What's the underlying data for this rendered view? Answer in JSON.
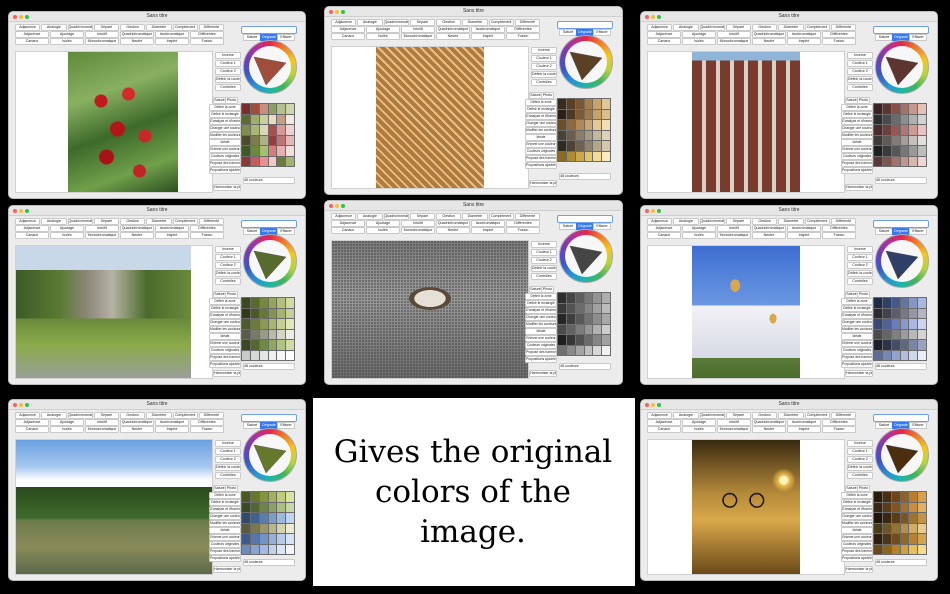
{
  "caption": [
    "Gives the original",
    "colors of the image."
  ],
  "window": {
    "title": "Sans titre",
    "top_buttons_row1": [
      "Adjacence",
      "Analogie",
      "Quadrichromatique",
      "Séparé",
      "Gestion",
      "Diamètre",
      "Complément",
      "Différenté"
    ],
    "top_buttons_row2": [
      "Adjacence",
      "Ajoutage",
      "Intuitif",
      "Quadrichromatique",
      "Isochromatique",
      "Différentes"
    ],
    "top_buttons_row3": [
      "Canaux",
      "Isolés",
      "Monochromatique",
      "Neutre",
      "Inspiré",
      "Fusion"
    ],
    "color_tabs": [
      "Saturé",
      "Dégradé",
      "Effacer"
    ],
    "wheel_buttons": [
      "Inverse",
      "Couleur 1",
      "Couleur 2",
      "Définir la couleur",
      "Contrôles"
    ],
    "swatch_tabs": [
      "Saturé",
      "Photo"
    ],
    "left_buttons": [
      "Définir la zone",
      "Définir le rectangle",
      "D'analyse et d'harmonisation",
      "Changer une couleur",
      "Modifier les couleurs",
      "Idéale",
      "Enlever une couleur",
      "Couleurs originales",
      "Propose des harmonies",
      "Propositions ajoutées aux ensembles"
    ],
    "bottom_buttons": [
      "Harmoniser la photo",
      "48 couleurs"
    ]
  },
  "windows": [
    {
      "name": "currants",
      "palette": [
        "#7a2c2e",
        "#a04e3b",
        "#c98f7d",
        "#8aa163",
        "#b6c08a",
        "#d0d4b0",
        "#5e6b2f",
        "#9fae6b",
        "#c8cf9c",
        "#e6dcc8",
        "#c0a087",
        "#f1e9e0",
        "#7e8f4d",
        "#a7b774",
        "#dcd6b8",
        "#b04a4f",
        "#d89a98",
        "#edd4d2",
        "#4a4b28",
        "#7d7e47",
        "#b0b186",
        "#9b3b3e",
        "#c27475",
        "#e4b8b7",
        "#3b5920",
        "#6d8a3a",
        "#a4bf6d",
        "#d87b7c",
        "#eab0b0",
        "#f6dede",
        "#8c3837",
        "#c75a5b",
        "#e69090",
        "#f3c8c9",
        "#6b7d3a",
        "#a3b275"
      ]
    },
    {
      "name": "bar",
      "palette": [
        "#3a2a1a",
        "#5a4024",
        "#7a5730",
        "#a67d45",
        "#c9a46a",
        "#e0c896",
        "#2b1e12",
        "#4e3821",
        "#7b5a34",
        "#9e7a46",
        "#c7a168",
        "#dcc08a",
        "#6b4e2c",
        "#8d6a3d",
        "#b08a54",
        "#caa66f",
        "#e2c894",
        "#f0dfb5",
        "#4a4034",
        "#6b5d4b",
        "#8d7e66",
        "#a89a80",
        "#c4b89e",
        "#ddd2b8",
        "#2f2a22",
        "#4d4436",
        "#6d624f",
        "#8f836b",
        "#b2a68b",
        "#d2c7ab",
        "#8a6a25",
        "#ae8a33",
        "#cca848",
        "#e2c56a",
        "#f0dc94",
        "#f9ecc0"
      ]
    },
    {
      "name": "building",
      "palette": [
        "#3b2220",
        "#5e3431",
        "#83504a",
        "#a97066",
        "#c9968b",
        "#e5c1b8",
        "#2c2c2c",
        "#4a4a4a",
        "#6b6b6b",
        "#8e8e8e",
        "#b0b0b0",
        "#d2d2d2",
        "#4a2b2a",
        "#6d3f3d",
        "#905956",
        "#b27873",
        "#cf9b95",
        "#e9c3bd",
        "#3d3a38",
        "#5e5a57",
        "#817c78",
        "#a49e99",
        "#c5c0bb",
        "#e3dfdb",
        "#1f1f1f",
        "#3a3a3a",
        "#575757",
        "#777777",
        "#9a9a9a",
        "#bdbdbd",
        "#5a3a36",
        "#7d5550",
        "#a0746e",
        "#bf958e",
        "#d8b6b0",
        "#eed6d1"
      ]
    },
    {
      "name": "stone-house",
      "palette": [
        "#3a4a1e",
        "#566b2c",
        "#74893e",
        "#94a657",
        "#b4c07a",
        "#d3d9a4",
        "#2e3a18",
        "#485a26",
        "#647838",
        "#83964f",
        "#a3b26f",
        "#c6cf98",
        "#4d5a2a",
        "#6c7b3b",
        "#8b9a52",
        "#a9b66e",
        "#c7cf92",
        "#e1e6bc",
        "#5b5b4d",
        "#7a7a6a",
        "#9a9a89",
        "#b9b9a9",
        "#d6d6c8",
        "#eeeee4",
        "#384a22",
        "#526a30",
        "#6f8a44",
        "#8fa85d",
        "#b0c37f",
        "#d0dca7",
        "#c6cac9",
        "#d5d9d8",
        "#e2e6e5",
        "#eef1f0",
        "#f6f8f7",
        "#ffffff"
      ]
    },
    {
      "name": "dog",
      "palette": [
        "#2d2d2d",
        "#454545",
        "#5e5e5e",
        "#787878",
        "#939393",
        "#aeaeae",
        "#3a3a3a",
        "#525252",
        "#6c6c6c",
        "#868686",
        "#a1a1a1",
        "#bcbcbc",
        "#262626",
        "#3e3e3e",
        "#585858",
        "#727272",
        "#8d8d8d",
        "#a8a8a8",
        "#4a4a4a",
        "#636363",
        "#7d7d7d",
        "#979797",
        "#b2b2b2",
        "#cdcdcd",
        "#1e1e1e",
        "#363636",
        "#505050",
        "#6a6a6a",
        "#858585",
        "#a0a0a0",
        "#707070",
        "#8a8a8a",
        "#a4a4a4",
        "#bebebe",
        "#d8d8d8",
        "#f0f0f0"
      ]
    },
    {
      "name": "church",
      "palette": [
        "#1e2a4a",
        "#2f3f68",
        "#455887",
        "#6275a6",
        "#8496c4",
        "#aab9df",
        "#2a2a33",
        "#42424f",
        "#5c5c6c",
        "#78788a",
        "#9595a8",
        "#b4b4c6",
        "#3a4a76",
        "#506298",
        "#6a7db6",
        "#8899cf",
        "#a9b6e2",
        "#cbd4f0",
        "#4b4b4b",
        "#656565",
        "#808080",
        "#9c9c9c",
        "#b8b8b8",
        "#d4d4d4",
        "#1b1f2e",
        "#2e3448",
        "#454d66",
        "#5e6884",
        "#7a85a2",
        "#98a3c0",
        "#5a6c9a",
        "#7587b4",
        "#92a3cc",
        "#b0bfe0",
        "#cdd8ef",
        "#e8eefa"
      ]
    },
    {
      "name": "lake",
      "palette": [
        "#4a5a1e",
        "#66782c",
        "#83963e",
        "#a2b258",
        "#c0cc7c",
        "#dbe2a6",
        "#3a4a24",
        "#526633",
        "#6e8448",
        "#8ca262",
        "#aabe82",
        "#c9d7a8",
        "#2e4a6e",
        "#41628e",
        "#5a7eac",
        "#7a9cc8",
        "#9cb9dd",
        "#c2d5ee",
        "#5b5a3a",
        "#7a7852",
        "#9a976d",
        "#b9b68c",
        "#d6d3ae",
        "#edebd2",
        "#3d5a8c",
        "#5676aa",
        "#7393c4",
        "#94afd9",
        "#b5cae9",
        "#d6e3f5",
        "#6a8ac0",
        "#86a3d2",
        "#a3bbe1",
        "#c0d2ed",
        "#dbe6f6",
        "#f2f6fc"
      ]
    },
    {
      "name": "bicycle",
      "palette": [
        "#2a1a08",
        "#4a2e0e",
        "#6e4616",
        "#94601f",
        "#ba7d2b",
        "#d9a04a",
        "#3a2610",
        "#5c3c17",
        "#805520",
        "#a66f2c",
        "#c98d3f",
        "#e2b062",
        "#1e1408",
        "#3a2810",
        "#5a3e18",
        "#7c5622",
        "#a0722f",
        "#c29346",
        "#4a3a1a",
        "#6c5526",
        "#907236",
        "#b3904b",
        "#d0ad68",
        "#e8cb90",
        "#2c1e0c",
        "#4c3414",
        "#6e4c1c",
        "#916627",
        "#b48336",
        "#d2a452",
        "#6a4a14",
        "#8e641c",
        "#b28128",
        "#d1a03c",
        "#e7c05e",
        "#f5dc8c"
      ]
    }
  ]
}
